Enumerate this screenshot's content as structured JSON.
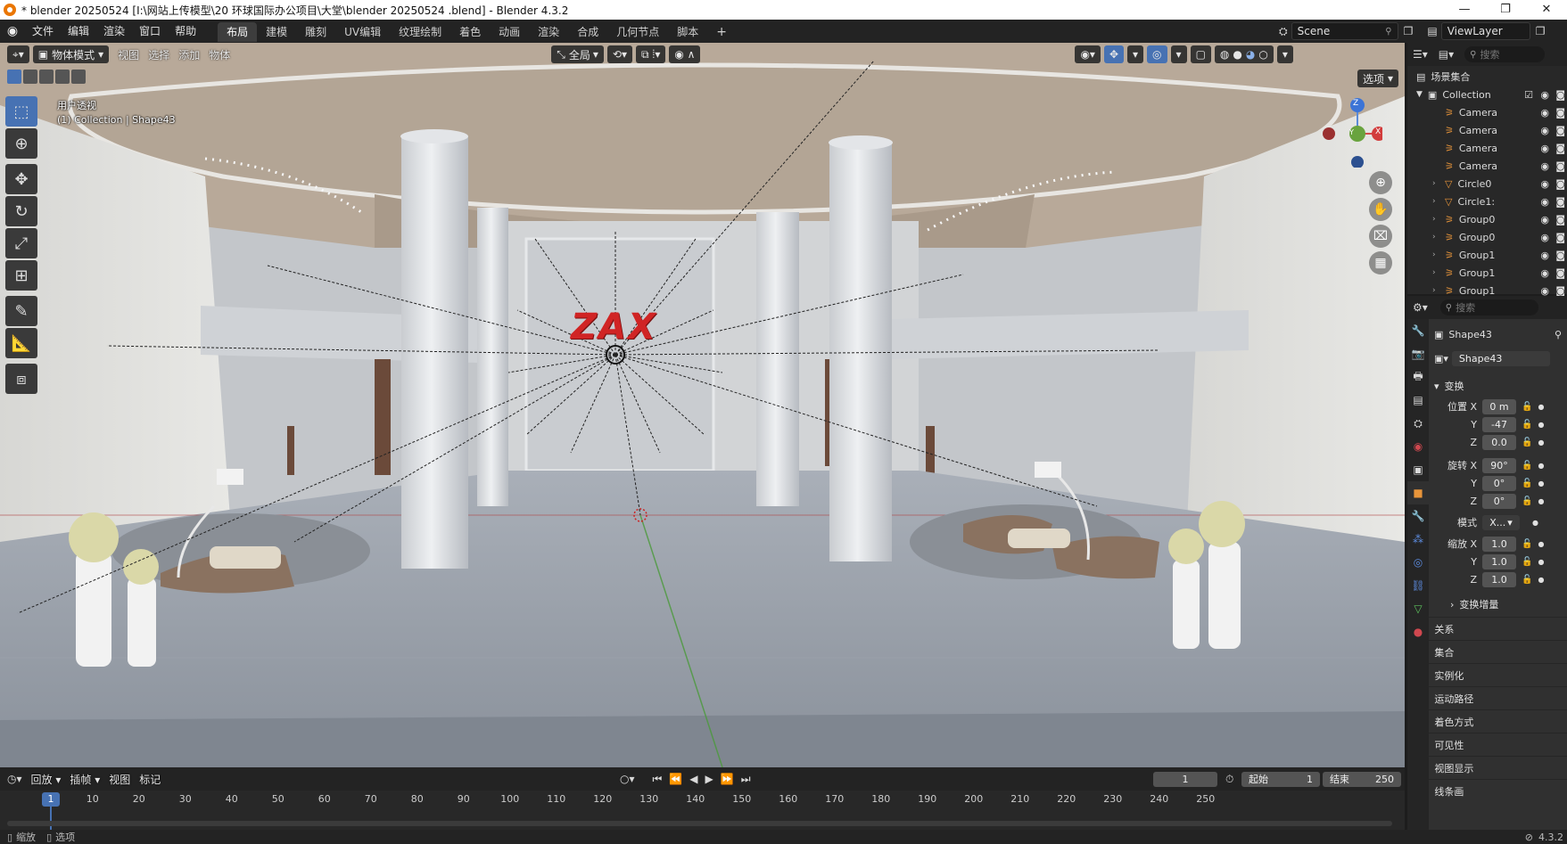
{
  "window": {
    "title": "* blender 20250524  [I:\\网站上传模型\\20 环球国际办公项目\\大堂\\blender 20250524 .blend] - Blender 4.3.2",
    "controls": [
      "—",
      "❐",
      "✕"
    ]
  },
  "menu": {
    "items": [
      "文件",
      "编辑",
      "渲染",
      "窗口",
      "帮助"
    ],
    "workspaces": [
      "布局",
      "建模",
      "雕刻",
      "UV编辑",
      "纹理绘制",
      "着色",
      "动画",
      "渲染",
      "合成",
      "几何节点",
      "脚本"
    ],
    "active_workspace": "布局",
    "add_tab": "+",
    "scene": "Scene",
    "view_layer": "ViewLayer"
  },
  "viewport": {
    "mode": "物体模式",
    "menus": [
      "视图",
      "选择",
      "添加",
      "物体"
    ],
    "transform_orientation": "全局",
    "options_label": "选项",
    "perspective_label": "用户透视",
    "context_label": "(1) Collection | Shape43",
    "gizmo": {
      "x": "X",
      "y": "Y",
      "z": "Z"
    },
    "sign_text": "ZAX"
  },
  "outliner": {
    "search_placeholder": "搜索",
    "root": "场景集合",
    "collection": "Collection",
    "items": [
      {
        "name": "Camera",
        "type": "camera"
      },
      {
        "name": "Camera",
        "type": "camera"
      },
      {
        "name": "Camera",
        "type": "camera"
      },
      {
        "name": "Camera",
        "type": "camera"
      },
      {
        "name": "Circle0",
        "type": "mesh"
      },
      {
        "name": "Circle1:",
        "type": "mesh"
      },
      {
        "name": "Group0",
        "type": "empty"
      },
      {
        "name": "Group0",
        "type": "empty"
      },
      {
        "name": "Group1",
        "type": "empty"
      },
      {
        "name": "Group1",
        "type": "empty"
      },
      {
        "name": "Group1",
        "type": "empty"
      }
    ]
  },
  "properties": {
    "search_placeholder": "搜索",
    "object_name": "Shape43",
    "object_field": "Shape43",
    "transform_header": "变换",
    "location": {
      "label": "位置 X",
      "x": "0 m",
      "y": "-47",
      "z": "0.0"
    },
    "rotation": {
      "label": "旋转 X",
      "x": "90°",
      "y": "0°",
      "z": "0°"
    },
    "mode": {
      "label": "模式",
      "value": "X..."
    },
    "scale": {
      "label": "缩放 X",
      "x": "1.0",
      "y": "1.0",
      "z": "1.0"
    },
    "axis_y": "Y",
    "axis_z": "Z",
    "delta_transform": "变换增量",
    "sections": [
      "关系",
      "集合",
      "实例化",
      "运动路径",
      "着色方式",
      "可见性",
      "视图显示",
      "线条画"
    ]
  },
  "timeline": {
    "menus": [
      "回放",
      "插帧",
      "视图",
      "标记"
    ],
    "current_frame": "1",
    "start_label": "起始",
    "start": "1",
    "end_label": "结束",
    "end": "250",
    "ruler": [
      "10",
      "20",
      "30",
      "40",
      "50",
      "60",
      "70",
      "80",
      "90",
      "100",
      "110",
      "120",
      "130",
      "140",
      "150",
      "160",
      "170",
      "180",
      "190",
      "200",
      "210",
      "220",
      "230",
      "240",
      "250"
    ],
    "playhead": "1"
  },
  "statusbar": {
    "left": [
      "缩放",
      "选项"
    ],
    "version": "4.3.2"
  },
  "colors": {
    "accent": "#4772b3",
    "header": "#232323",
    "panel": "#303030",
    "sign": "#d02424"
  }
}
